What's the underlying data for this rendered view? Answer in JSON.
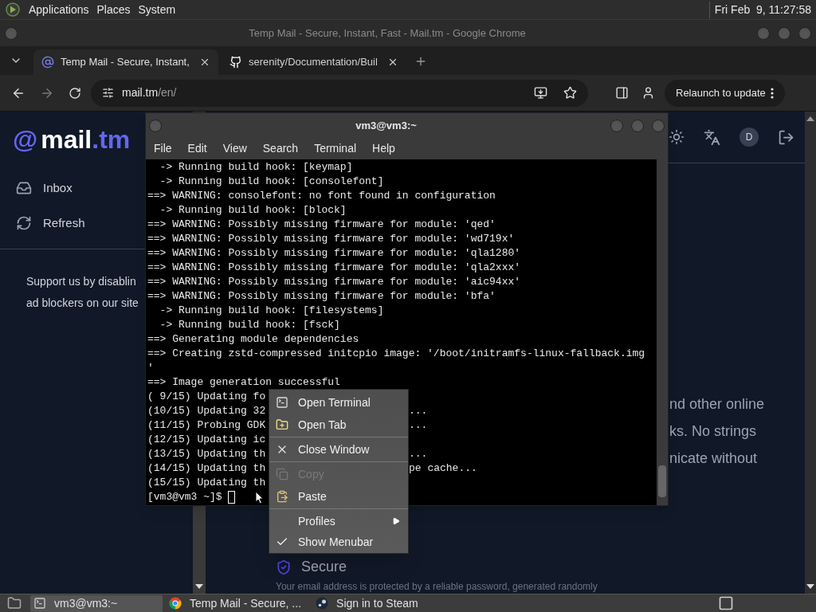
{
  "top_panel": {
    "menus": [
      "Applications",
      "Places",
      "System"
    ],
    "clock": "Fri Feb  9, 11:27:58"
  },
  "browser": {
    "title": "Temp Mail - Secure, Instant, Fast - Mail.tm - Google Chrome",
    "tabs": [
      {
        "title": "Temp Mail - Secure, Instant,",
        "selected": true
      },
      {
        "title": "serenity/Documentation/Buil",
        "selected": false
      }
    ],
    "address": {
      "host": "mail.tm",
      "path": "/en/"
    },
    "relaunch": "Relaunch to update"
  },
  "page": {
    "logo": {
      "mark": "@",
      "name": "mail",
      "tld": ".tm"
    },
    "nav": [
      {
        "label": "Inbox"
      },
      {
        "label": "Refresh"
      }
    ],
    "support_lines": [
      "Support us by disablin",
      "ad blockers on our site"
    ],
    "avatar": "D",
    "body_lines": [
      "nd other online",
      "ks. No strings",
      "nicate without"
    ],
    "feature": {
      "title": "Secure",
      "text": "Your email address is protected by a reliable password, generated randomly"
    }
  },
  "terminal": {
    "title": "vm3@vm3:~",
    "menu": [
      "File",
      "Edit",
      "View",
      "Search",
      "Terminal",
      "Help"
    ],
    "lines": [
      {
        "text": "  -> Running build hook: [keymap]"
      },
      {
        "text": "  -> Running build hook: [consolefont]"
      },
      {
        "text": "==> WARNING: consolefont: no font found in configuration"
      },
      {
        "text": "  -> Running build hook: [block]"
      },
      {
        "text": "==> WARNING: Possibly missing firmware for module: 'qed'"
      },
      {
        "text": "==> WARNING: Possibly missing firmware for module: 'wd719x'"
      },
      {
        "text": "==> WARNING: Possibly missing firmware for module: 'qla1280'"
      },
      {
        "text": "==> WARNING: Possibly missing firmware for module: 'qla2xxx'"
      },
      {
        "text": "==> WARNING: Possibly missing firmware for module: 'aic94xx'"
      },
      {
        "text": "==> WARNING: Possibly missing firmware for module: 'bfa'"
      },
      {
        "text": "  -> Running build hook: [filesystems]"
      },
      {
        "text": "  -> Running build hook: [fsck]"
      },
      {
        "text": "==> Generating module dependencies"
      },
      {
        "text": "==> Creating zstd-compressed initcpio image: '/boot/initramfs-linux-fallback.img"
      },
      {
        "text": "'"
      },
      {
        "text": "==> Image generation successful"
      },
      {
        "text": "( 9/15) Updating fo"
      },
      {
        "text": "(10/15) Updating 32",
        "tail": "..."
      },
      {
        "text": "(11/15) Probing GDK",
        "tail": "..."
      },
      {
        "text": "(12/15) Updating ic"
      },
      {
        "text": "(13/15) Updating th",
        "tail": "..."
      },
      {
        "text": "(14/15) Updating th",
        "tail": "pe cache..."
      },
      {
        "text": "(15/15) Updating th"
      }
    ],
    "prompt": "[vm3@vm3 ~]$ "
  },
  "context_menu": {
    "items": [
      {
        "kind": "item",
        "label": "Open Terminal",
        "disabled": false
      },
      {
        "kind": "item",
        "label": "Open Tab",
        "disabled": false
      },
      {
        "kind": "separator"
      },
      {
        "kind": "item",
        "label": "Close Window",
        "disabled": false
      },
      {
        "kind": "separator"
      },
      {
        "kind": "item",
        "label": "Copy",
        "disabled": true
      },
      {
        "kind": "item",
        "label": "Paste",
        "disabled": false
      },
      {
        "kind": "separator"
      },
      {
        "kind": "submenu",
        "label": "Profiles"
      },
      {
        "kind": "check",
        "label": "Show Menubar",
        "checked": true
      }
    ]
  },
  "taskbar": {
    "items": [
      {
        "label": "vm3@vm3:~",
        "selected": true
      },
      {
        "label": "Temp Mail - Secure, ...",
        "selected": false
      },
      {
        "label": "Sign in to Steam",
        "selected": false
      }
    ]
  }
}
